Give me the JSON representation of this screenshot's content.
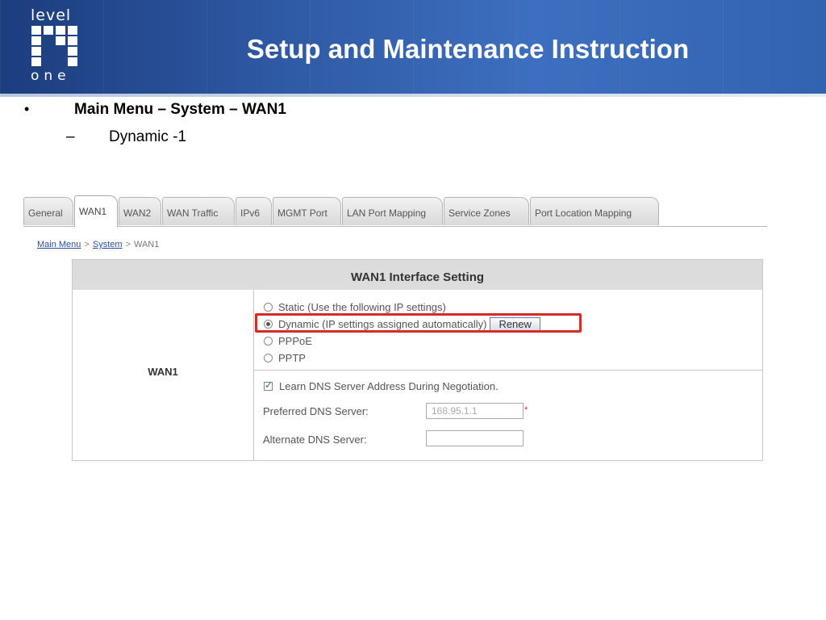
{
  "header": {
    "title": "Setup and Maintenance Instruction",
    "logo_top": "level",
    "logo_bottom": "one",
    "brand_color": "#2f5aa5"
  },
  "bullets": {
    "level1_marker": "•",
    "level1": "Main Menu – System – WAN1",
    "level2_marker": "–",
    "level2": "Dynamic -1"
  },
  "tabs": [
    {
      "label": "General",
      "active": false
    },
    {
      "label": "WAN1",
      "active": true
    },
    {
      "label": "WAN2",
      "active": false
    },
    {
      "label": "WAN Traffic",
      "active": false
    },
    {
      "label": "IPv6",
      "active": false
    },
    {
      "label": "MGMT Port",
      "active": false
    },
    {
      "label": "LAN Port Mapping",
      "active": false
    },
    {
      "label": "Service Zones",
      "active": false
    },
    {
      "label": "Port Location Mapping",
      "active": false
    }
  ],
  "breadcrumb": {
    "items": [
      "Main Menu",
      "System",
      "WAN1"
    ],
    "separator": ">"
  },
  "settings": {
    "heading": "WAN1 Interface Setting",
    "row_label": "WAN1",
    "options": [
      {
        "label": "Static (Use the following IP settings)",
        "selected": false
      },
      {
        "label": "Dynamic (IP settings assigned automatically)",
        "selected": true
      },
      {
        "label": "PPPoE",
        "selected": false
      },
      {
        "label": "PPTP",
        "selected": false
      }
    ],
    "renew_label": "Renew",
    "dns_learn_label": "Learn DNS Server Address During Negotiation.",
    "dns_learn_checked": true,
    "preferred_dns_label": "Preferred DNS Server:",
    "preferred_dns_value": "168.95.1.1",
    "required_marker": "*",
    "alternate_dns_label": "Alternate DNS Server:",
    "alternate_dns_value": "",
    "highlight_color": "#d62b2b"
  }
}
